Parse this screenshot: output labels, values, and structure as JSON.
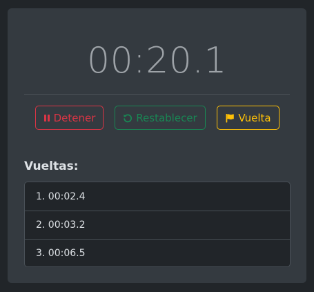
{
  "stopwatch": {
    "time": "00:20.1"
  },
  "buttons": {
    "stop_label": "Detener",
    "reset_label": "Restablecer",
    "lap_label": "Vuelta"
  },
  "laps": {
    "title": "Vueltas:",
    "items": [
      {
        "label": "1. 00:02.4"
      },
      {
        "label": "2. 00:03.2"
      },
      {
        "label": "3. 00:06.5"
      }
    ]
  },
  "icons": {
    "stop": "pause-icon",
    "reset": "rotate-left-icon",
    "lap": "flag-icon"
  },
  "colors": {
    "stop": "#dc3545",
    "reset": "#198754",
    "lap": "#ffc107"
  }
}
